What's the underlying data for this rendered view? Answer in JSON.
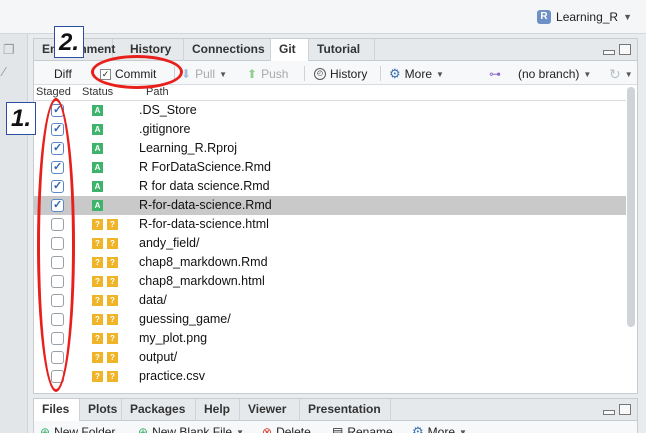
{
  "project": {
    "name": "Learning_R"
  },
  "tabs": [
    "Environment",
    "History",
    "Connections",
    "Git",
    "Tutorial"
  ],
  "active_tab": "Git",
  "toolbar": {
    "diff": "Diff",
    "commit": "Commit",
    "pull": "Pull",
    "push": "Push",
    "history": "History",
    "more": "More",
    "branch": "(no branch)"
  },
  "columns": {
    "staged": "Staged",
    "status": "Status",
    "path": "Path"
  },
  "files": [
    {
      "staged": true,
      "status": "A",
      "path": ".DS_Store"
    },
    {
      "staged": true,
      "status": "A",
      "path": ".gitignore"
    },
    {
      "staged": true,
      "status": "A",
      "path": "Learning_R.Rproj"
    },
    {
      "staged": true,
      "status": "A",
      "path": "R ForDataScience.Rmd"
    },
    {
      "staged": true,
      "status": "A",
      "path": "R for data science.Rmd"
    },
    {
      "staged": true,
      "status": "A",
      "path": "R-for-data-science.Rmd",
      "selected": true
    },
    {
      "staged": false,
      "status": "??",
      "path": "R-for-data-science.html"
    },
    {
      "staged": false,
      "status": "??",
      "path": "andy_field/"
    },
    {
      "staged": false,
      "status": "??",
      "path": "chap8_markdown.Rmd"
    },
    {
      "staged": false,
      "status": "??",
      "path": "chap8_markdown.html"
    },
    {
      "staged": false,
      "status": "??",
      "path": "data/"
    },
    {
      "staged": false,
      "status": "??",
      "path": "guessing_game/"
    },
    {
      "staged": false,
      "status": "??",
      "path": "my_plot.png"
    },
    {
      "staged": false,
      "status": "??",
      "path": "output/"
    },
    {
      "staged": false,
      "status": "??",
      "path": "practice.csv"
    }
  ],
  "bottom_tabs": [
    "Files",
    "Plots",
    "Packages",
    "Help",
    "Viewer",
    "Presentation"
  ],
  "bottom_toolbar": {
    "new_folder": "New Folder",
    "new_blank_file": "New Blank File",
    "delete": "Delete",
    "rename": "Rename",
    "more": "More"
  },
  "annotations": {
    "one": "1.",
    "two": "2."
  },
  "colors": {
    "staged_added": "#3db36b",
    "untracked": "#f0b429",
    "annotation_red": "#e8201c",
    "selected_row": "#c9c9c9"
  }
}
